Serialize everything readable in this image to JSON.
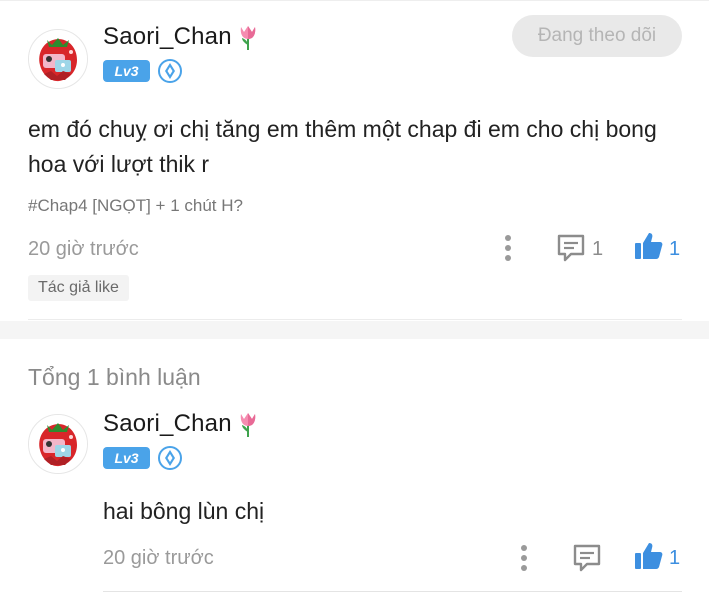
{
  "main_comment": {
    "username": "Saori_Chan",
    "level_badge": "Lv3",
    "follow_button": "Đang theo dõi",
    "text": "em đó chuỵ ơi chị tăng em thêm một chap đi em cho chị bong hoa với lượt thik r",
    "chapter_tag": "#Chap4 [NGỌT] + 1 chút H?",
    "time": "20 giờ trước",
    "reply_count": "1",
    "like_count": "1",
    "author_like": "Tác giả like"
  },
  "replies_section": {
    "total_label": "Tổng 1 bình luận",
    "replies": [
      {
        "username": "Saori_Chan",
        "level_badge": "Lv3",
        "text": "hai bông lùn chị",
        "time": "20 giờ trước",
        "like_count": "1"
      }
    ]
  },
  "colors": {
    "accent_blue": "#3d8fe0",
    "badge_blue": "#4aa3e9",
    "follow_bg": "#e9e9e9"
  },
  "icons": [
    "avatar-strawberry",
    "tulip-icon",
    "rank-shield-icon",
    "more-vertical-icon",
    "comment-icon",
    "thumbs-up-icon"
  ]
}
